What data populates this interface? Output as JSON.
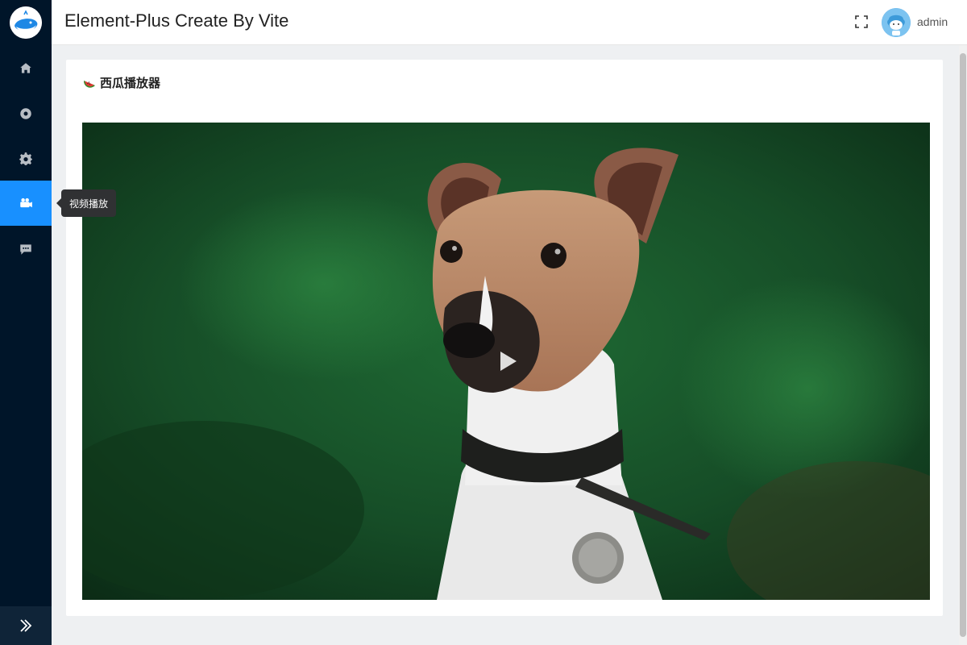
{
  "header": {
    "title": "Element-Plus Create By Vite",
    "username": "admin"
  },
  "sidebar": {
    "items": [
      {
        "icon": "home-icon",
        "label": ""
      },
      {
        "icon": "compass-icon",
        "label": ""
      },
      {
        "icon": "gear-icon",
        "label": ""
      },
      {
        "icon": "video-camera-icon",
        "label": "视频播放",
        "active": true
      },
      {
        "icon": "message-icon",
        "label": ""
      }
    ],
    "tooltip": "视频播放",
    "collapse_icon": "double-chevron-right-icon"
  },
  "card": {
    "title": "西瓜播放器",
    "title_icon": "watermelon-icon"
  },
  "video": {
    "state": "paused",
    "poster_subject": "dog"
  },
  "colors": {
    "sidebar_bg": "#001529",
    "active": "#1890ff",
    "header_bg": "#ffffff"
  }
}
